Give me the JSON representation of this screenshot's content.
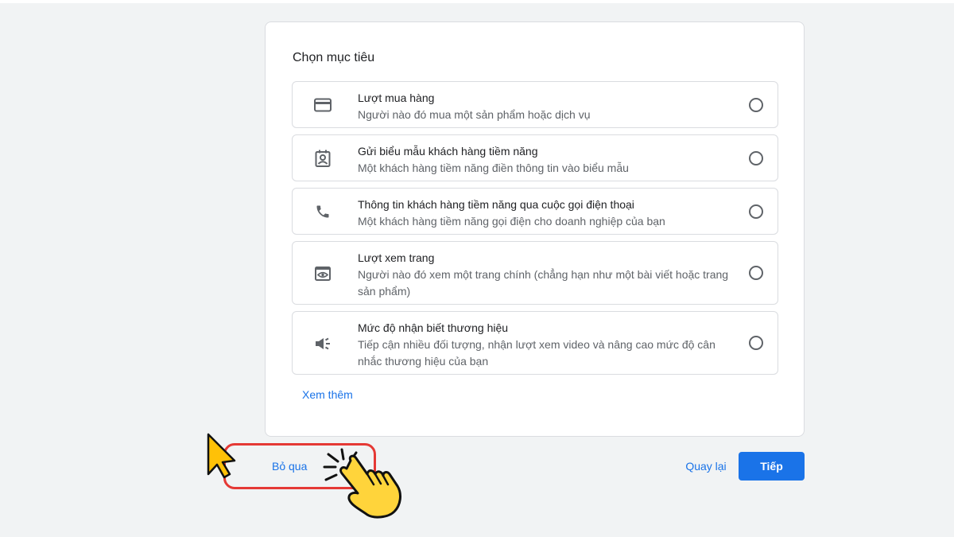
{
  "card": {
    "title": "Chọn mục tiêu",
    "options": [
      {
        "title": "Lượt mua hàng",
        "desc": "Người nào đó mua một sản phẩm hoặc dịch vụ",
        "icon": "credit-card-icon"
      },
      {
        "title": "Gửi biểu mẫu khách hàng tiềm năng",
        "desc": "Một khách hàng tiềm năng điền thông tin vào biểu mẫu",
        "icon": "contact-form-icon"
      },
      {
        "title": "Thông tin khách hàng tiềm năng qua cuộc gọi điện thoại",
        "desc": "Một khách hàng tiềm năng gọi điện cho doanh nghiệp của bạn",
        "icon": "phone-icon"
      },
      {
        "title": "Lượt xem trang",
        "desc": "Người nào đó xem một trang chính (chẳng hạn như một bài viết hoặc trang sản phẩm)",
        "icon": "page-view-icon"
      },
      {
        "title": "Mức độ nhận biết thương hiệu",
        "desc": "Tiếp cận nhiều đối tượng, nhận lượt xem video và nâng cao mức độ cân nhắc thương hiệu của bạn",
        "icon": "megaphone-icon"
      }
    ],
    "more_link": "Xem thêm"
  },
  "footer": {
    "skip_label": "Bỏ qua",
    "back_label": "Quay lại",
    "next_label": "Tiếp"
  },
  "colors": {
    "accent": "#1a73e8",
    "highlight": "#e53935",
    "hand": "#ffd43b"
  }
}
